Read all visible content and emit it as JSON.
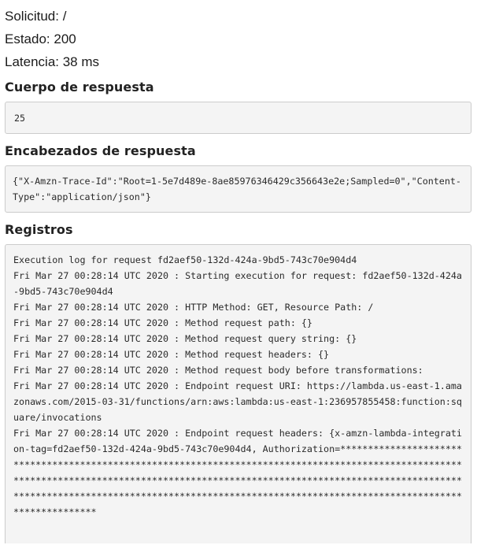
{
  "request": {
    "path_text": "Solicitud: /",
    "status_text": "Estado: 200",
    "latency_text": "Latencia: 38 ms"
  },
  "response_body": {
    "title": "Cuerpo de respuesta",
    "content": "25"
  },
  "response_headers": {
    "title": "Encabezados de respuesta",
    "content": "{\"X-Amzn-Trace-Id\":\"Root=1-5e7d489e-8ae85976346429c356643e2e;Sampled=0\",\"Content-Type\":\"application/json\"}"
  },
  "logs": {
    "title": "Registros",
    "lines": [
      "Execution log for request fd2aef50-132d-424a-9bd5-743c70e904d4",
      "Fri Mar 27 00:28:14 UTC 2020 : Starting execution for request: fd2aef50-132d-424a-9bd5-743c70e904d4",
      "Fri Mar 27 00:28:14 UTC 2020 : HTTP Method: GET, Resource Path: /",
      "Fri Mar 27 00:28:14 UTC 2020 : Method request path: {}",
      "Fri Mar 27 00:28:14 UTC 2020 : Method request query string: {}",
      "Fri Mar 27 00:28:14 UTC 2020 : Method request headers: {}",
      "Fri Mar 27 00:28:14 UTC 2020 : Method request body before transformations:",
      "Fri Mar 27 00:28:14 UTC 2020 : Endpoint request URI: https://lambda.us-east-1.amazonaws.com/2015-03-31/functions/arn:aws:lambda:us-east-1:236957855458:function:square/invocations",
      "Fri Mar 27 00:28:14 UTC 2020 : Endpoint request headers: {x-amzn-lambda-integration-tag=fd2aef50-132d-424a-9bd5-743c70e904d4, Authorization=****************************************************************************************************************************************************************************************************************************************************************************************"
    ]
  }
}
